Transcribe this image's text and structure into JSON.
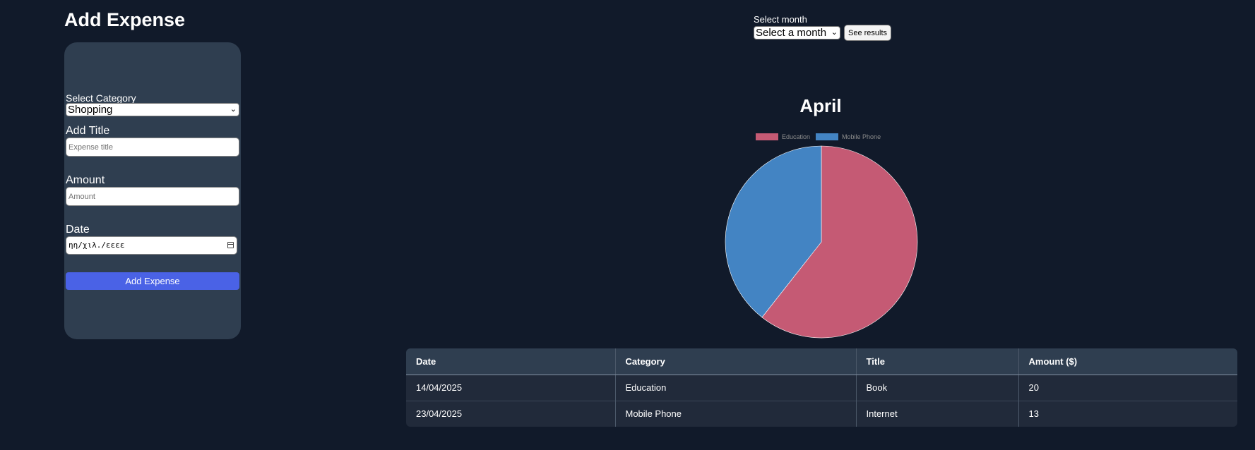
{
  "form": {
    "heading": "Add Expense",
    "category_label": "Select Category",
    "category_value": "Shopping",
    "title_label": "Add Title",
    "title_placeholder": "Expense title",
    "amount_label": "Amount",
    "amount_placeholder": "Amount",
    "date_label": "Date",
    "date_placeholder": "ηη/χιλ./εεεε",
    "submit_label": "Add Expense"
  },
  "month_picker": {
    "label": "Select month",
    "value": "Select a month",
    "button_label": "See results"
  },
  "chart_data": {
    "type": "pie",
    "title": "April",
    "legend_position": "top",
    "categories": [
      "Education",
      "Mobile Phone"
    ],
    "values": [
      20,
      13
    ],
    "colors": [
      "#c55a74",
      "#4384c3"
    ]
  },
  "table": {
    "columns": [
      "Date",
      "Category",
      "Title",
      "Amount ($)"
    ],
    "rows": [
      [
        "14/04/2025",
        "Education",
        "Book",
        "20"
      ],
      [
        "23/04/2025",
        "Mobile Phone",
        "Internet",
        "13"
      ]
    ]
  },
  "icons": {
    "select_chevron": "chevron-down-icon",
    "date_picker": "calendar-icon"
  }
}
